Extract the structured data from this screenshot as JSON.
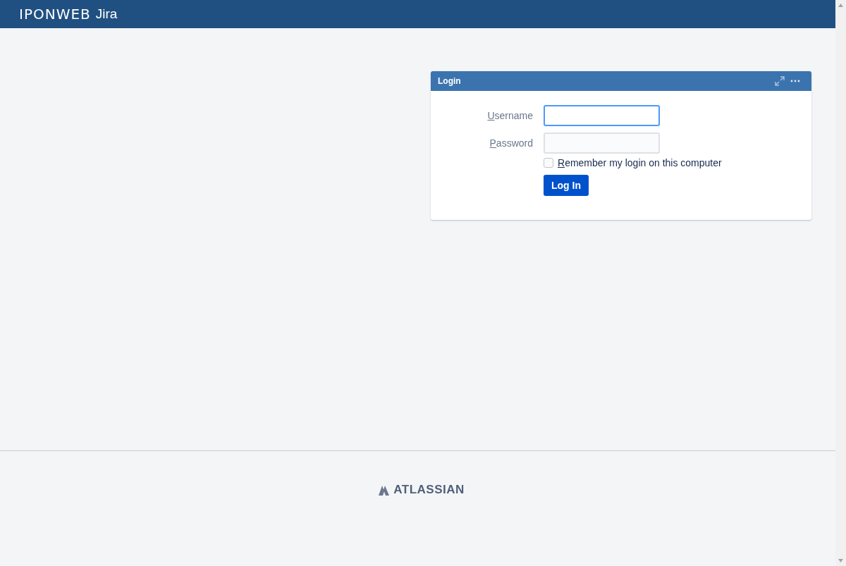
{
  "header": {
    "logo": "IPONWEB",
    "product": "Jira"
  },
  "login_gadget": {
    "title": "Login",
    "fields": [
      {
        "label": "Username",
        "focused": true
      },
      {
        "label": "Password",
        "focused": false
      }
    ],
    "remember": {
      "label": "Remember my login on this computer",
      "checked": false
    },
    "submit": "Log In"
  },
  "footer": {
    "brand": "ATLASSIAN"
  }
}
